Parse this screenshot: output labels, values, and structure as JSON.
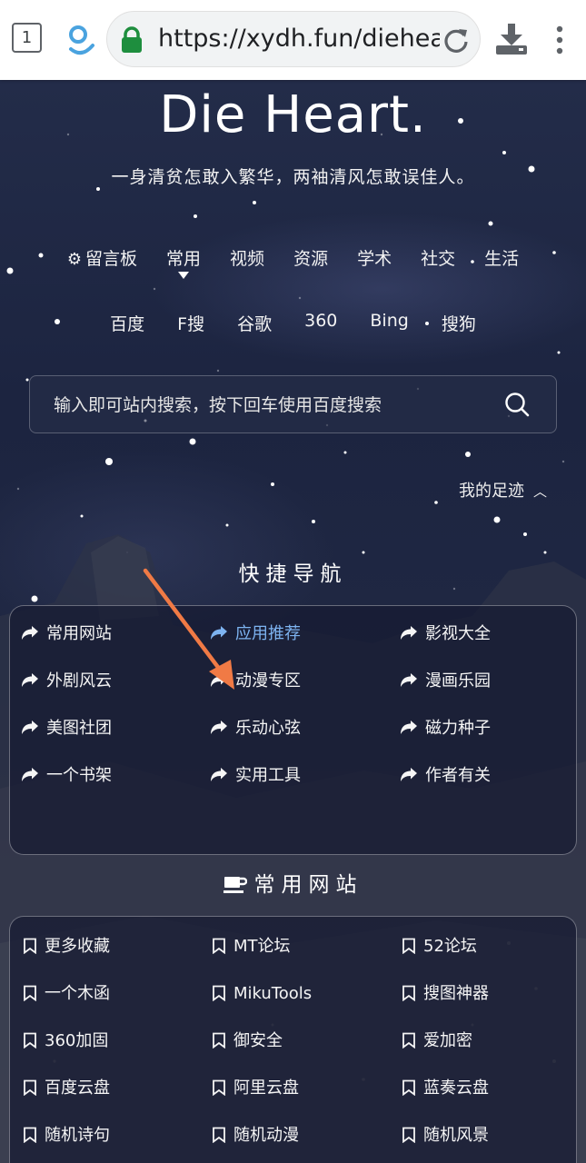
{
  "browser": {
    "tab_count": "1",
    "url": "https://xydh.fun/dieheart"
  },
  "site": {
    "title": "Die Heart.",
    "subtitle": "一身清贫怎敢入繁华，两袖清风怎敢误佳人。"
  },
  "nav": {
    "items": [
      "留言板",
      "常用",
      "视频",
      "资源",
      "学术",
      "社交",
      "生活"
    ],
    "active": "常用",
    "engines": [
      "百度",
      "F搜",
      "谷歌",
      "360",
      "Bing",
      "搜狗"
    ]
  },
  "search": {
    "placeholder": "输入即可站内搜索，按下回车使用百度搜索"
  },
  "footprint": {
    "label": "我的足迹"
  },
  "quick_nav": {
    "title": "快捷导航",
    "items": [
      "常用网站",
      "应用推荐",
      "影视大全",
      "外剧风云",
      "动漫专区",
      "漫画乐园",
      "美图社团",
      "乐动心弦",
      "磁力种子",
      "一个书架",
      "实用工具",
      "作者有关"
    ],
    "highlighted": "应用推荐"
  },
  "common_sites": {
    "title": "常用网站",
    "items": [
      "更多收藏",
      "MT论坛",
      "52论坛",
      "一个木函",
      "MikuTools",
      "搜图神器",
      "360加固",
      "御安全",
      "爱加密",
      "百度云盘",
      "阿里云盘",
      "蓝奏云盘",
      "随机诗句",
      "随机动漫",
      "随机风景"
    ]
  },
  "colors": {
    "highlight": "#7db3f0",
    "annotation_arrow": "#f07a45",
    "lock_green": "#1e8e3e"
  }
}
